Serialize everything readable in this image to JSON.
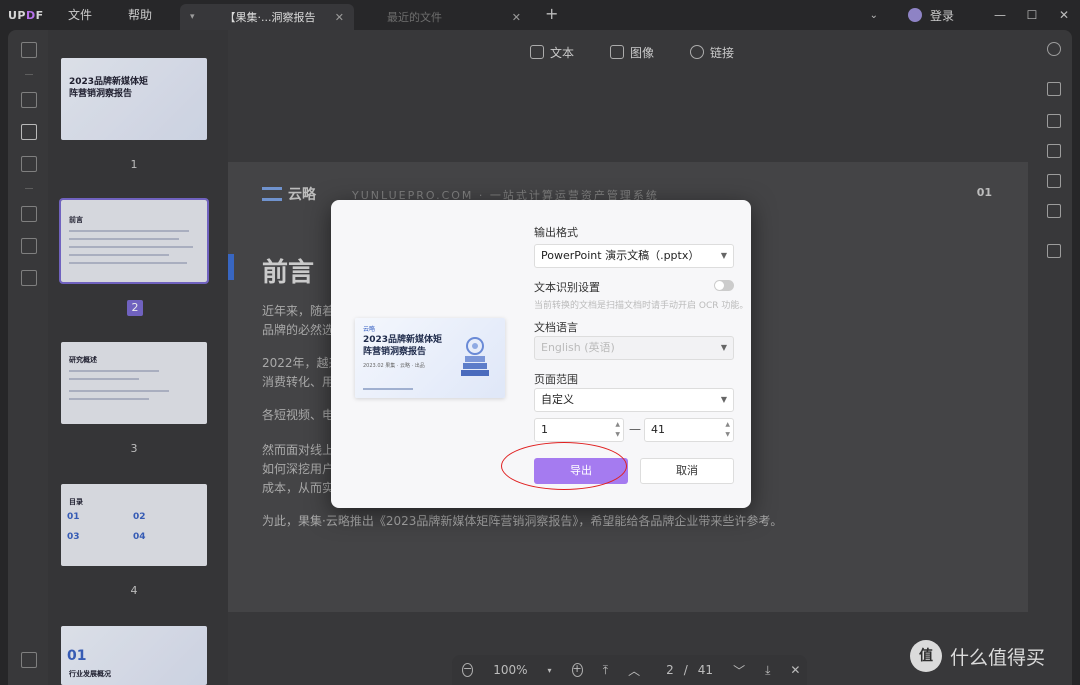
{
  "app": {
    "logo": "UPDF",
    "menu": [
      "文件",
      "帮助"
    ],
    "tabs": [
      {
        "label": "【果集·...洞察报告",
        "active": true
      },
      {
        "label": "最近的文件",
        "active": false
      }
    ],
    "login_label": "登录"
  },
  "viewer_toolbar": {
    "text": "文本",
    "image": "图像",
    "link": "链接"
  },
  "thumbnails": {
    "page_numbers": [
      "1",
      "2",
      "3",
      "4"
    ],
    "cover_title": "2023品牌新媒体矩阵营销洞察报告",
    "page2_title": "前言",
    "page3_title": "研究概述",
    "page4_title": "目录",
    "toc": [
      "01",
      "02",
      "03",
      "04"
    ],
    "page5_num": "01",
    "page5_title": "行业发展概况"
  },
  "page": {
    "brand": "云略",
    "brand_sub": "YUNLUEPRO.COM · 一站式计算运营资产管理系统",
    "page_number": "01",
    "title": "前言",
    "paragraphs": [
      "近年来，随着...                                                                    商等的驱动下，布局线上渠道已成为绝大多数",
      "品牌的必然选...",
      "2022年，越来...                                                                    矩阵化打造，实现从品牌曝光、内容种草到",
      "消费转化、用...",
      "各短视频、电...                                                                    台长效经营。",
      "然而面对线上...                                                                    设，实现全域经营、业绩增长？从流量到留量，",
      "如何深挖用户...                                                                    赋能数字化转型，提升运营效率，降低运营",
      "成本，从而实...",
      "为此，果集·云略推出《2023品牌新媒体矩阵营销洞察报告》，希望能给各品牌企业带来些许参考。"
    ]
  },
  "bottom_bar": {
    "zoom": "100%",
    "current_page": "2",
    "separator": "/",
    "total_pages": "41"
  },
  "dialog": {
    "preview_logo": "云略",
    "preview_title": "2023品牌新媒体矩阵营销洞察报告",
    "preview_sub": "2023.02 果集 · 云略 · 出品",
    "output_format_label": "输出格式",
    "output_format_value": "PowerPoint 演示文稿（.pptx）",
    "ocr_label": "文本识别设置",
    "ocr_hint": "当前转换的文档是扫描文档时请手动开启 OCR 功能。",
    "doc_language_label": "文档语言",
    "doc_language_value": "English (英语)",
    "page_range_label": "页面范围",
    "page_range_value": "自定义",
    "range_from": "1",
    "range_dash": "—",
    "range_to": "41",
    "export_label": "导出",
    "cancel_label": "取消"
  },
  "watermark": {
    "icon_text": "值",
    "text": "什么值得买"
  },
  "colors": {
    "accent": "#a57bf0",
    "annotation": "#e02020",
    "selected_thumb": "#7a6bd0"
  }
}
